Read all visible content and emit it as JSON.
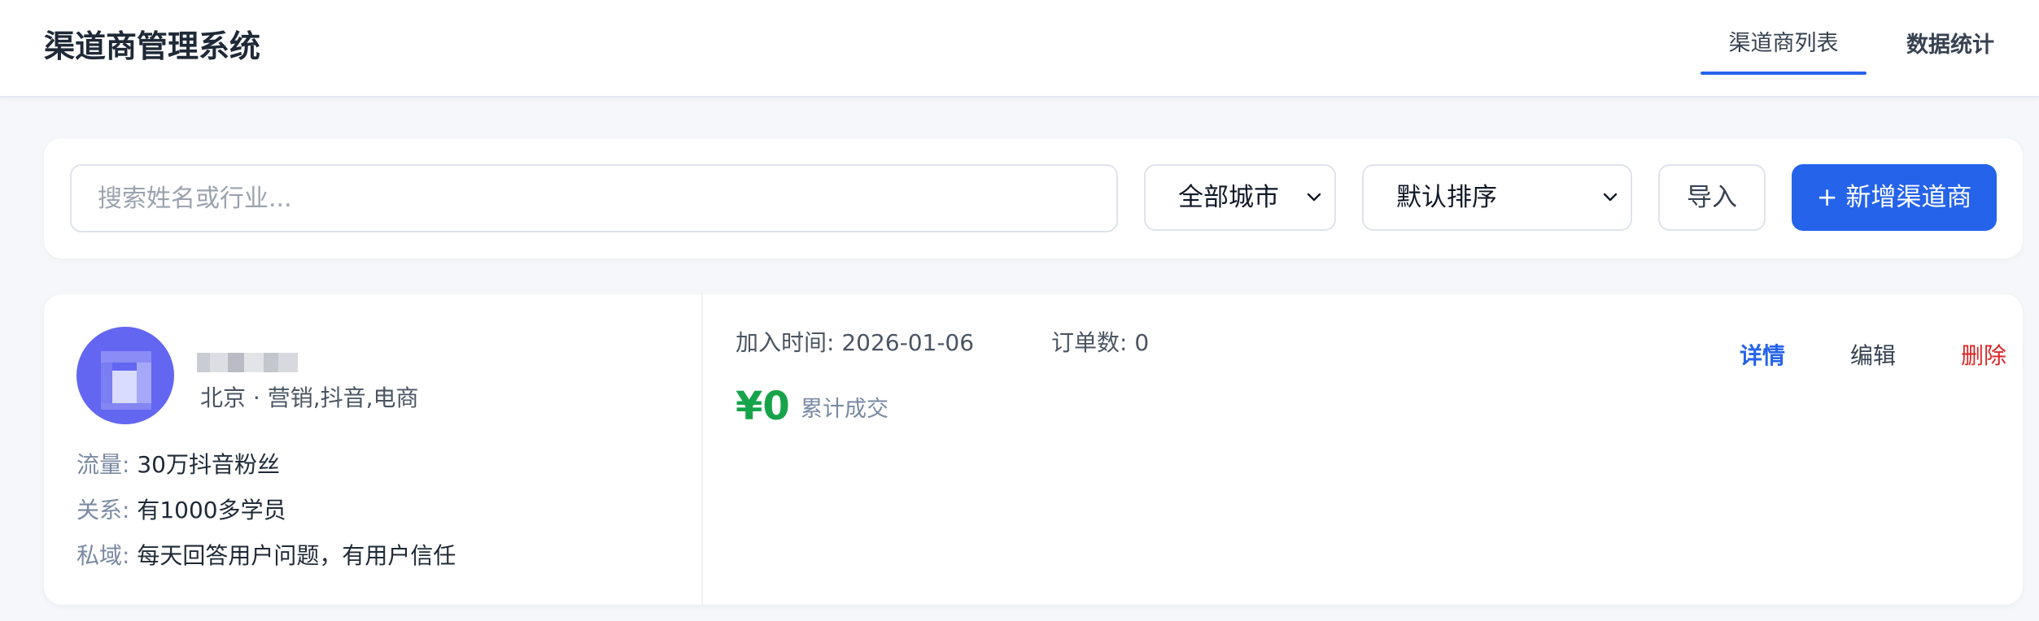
{
  "header": {
    "title": "渠道商管理系统",
    "tabs": [
      {
        "label": "渠道商列表",
        "active": true
      },
      {
        "label": "数据统计",
        "active": false
      }
    ]
  },
  "toolbar": {
    "search_placeholder": "搜索姓名或行业...",
    "city_select": "全部城市",
    "sort_select": "默认排序",
    "import_label": "导入",
    "add_label": "+ 新增渠道商"
  },
  "colors": {
    "accent": "#2563eb",
    "avatar": "#6366f1",
    "amount": "#16a34a",
    "delete": "#dc2626"
  },
  "channels": [
    {
      "meta": "北京 · 营销,抖音,电商",
      "traffic_label": "流量:",
      "traffic": "30万抖音粉丝",
      "relation_label": "关系:",
      "relation": "有1000多学员",
      "private_label": "私域:",
      "private": "每天回答用户问题，有用户信任",
      "joined": "加入时间: 2026-01-06",
      "orders": "订单数: 0",
      "amount": "¥0",
      "amount_label": "累计成交",
      "actions": {
        "detail": "详情",
        "edit": "编辑",
        "delete": "删除"
      }
    }
  ]
}
